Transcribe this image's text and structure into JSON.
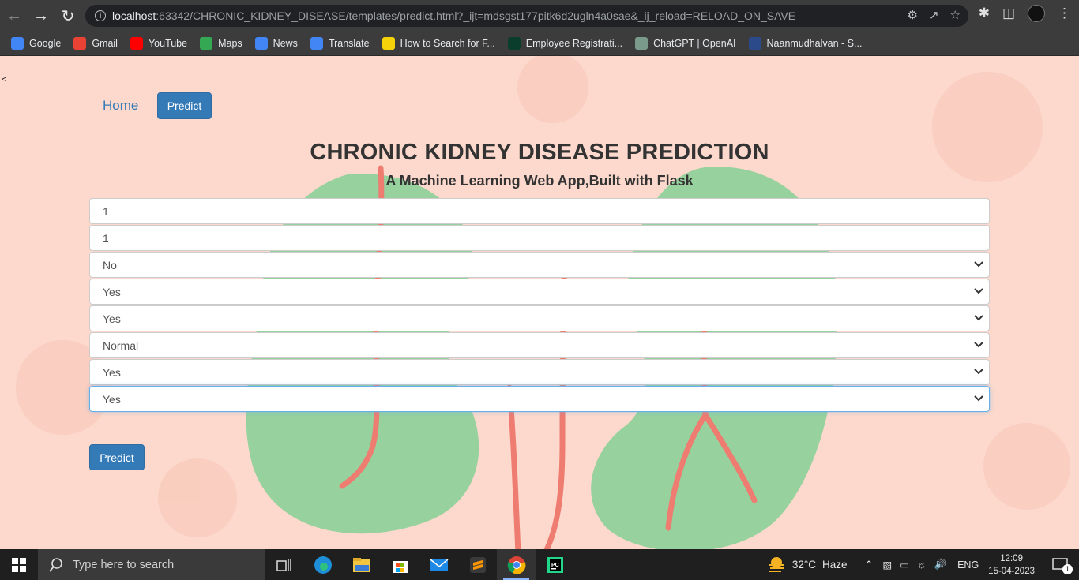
{
  "browser": {
    "url_host": "localhost",
    "url_rest": ":63342/CHRONIC_KIDNEY_DISEASE/templates/predict.html?_ijt=mdsgst177pitk6d2ugln4a0sae&_ij_reload=RELOAD_ON_SAVE",
    "bookmarks": [
      {
        "label": "Google",
        "icon": "google-icon",
        "color": "#4285f4"
      },
      {
        "label": "Gmail",
        "icon": "gmail-icon",
        "color": "#ea4335"
      },
      {
        "label": "YouTube",
        "icon": "youtube-icon",
        "color": "#ff0000"
      },
      {
        "label": "Maps",
        "icon": "maps-icon",
        "color": "#34a853"
      },
      {
        "label": "News",
        "icon": "news-icon",
        "color": "#4285f4"
      },
      {
        "label": "Translate",
        "icon": "translate-icon",
        "color": "#4285f4"
      },
      {
        "label": "How to Search for F...",
        "icon": "d-icon",
        "color": "#f5d20a"
      },
      {
        "label": "Employee Registrati...",
        "icon": "dot-icon",
        "color": "#0b3d2c"
      },
      {
        "label": "ChatGPT | OpenAI",
        "icon": "openai-icon",
        "color": "#7a9b8c"
      },
      {
        "label": "Naanmudhalvan - S...",
        "icon": "naan-icon",
        "color": "#2a4a8a"
      }
    ]
  },
  "page": {
    "stray_char": "<",
    "nav": {
      "home": "Home",
      "predict": "Predict"
    },
    "title": "CHRONIC KIDNEY DISEASE PREDICTION",
    "subtitle": "A Machine Learning Web App,Built with Flask",
    "fields": [
      {
        "type": "input",
        "value": "1"
      },
      {
        "type": "input",
        "value": "1"
      },
      {
        "type": "select",
        "value": "No"
      },
      {
        "type": "select",
        "value": "Yes"
      },
      {
        "type": "select",
        "value": "Yes"
      },
      {
        "type": "select",
        "value": "Normal"
      },
      {
        "type": "select",
        "value": "Yes"
      },
      {
        "type": "select",
        "value": "Yes",
        "focused": true
      }
    ],
    "submit": "Predict"
  },
  "taskbar": {
    "search_placeholder": "Type here to search",
    "weather_temp": "32°C",
    "weather_desc": "Haze",
    "language": "ENG",
    "time": "12:09",
    "date": "15-04-2023",
    "notification_count": "1"
  }
}
